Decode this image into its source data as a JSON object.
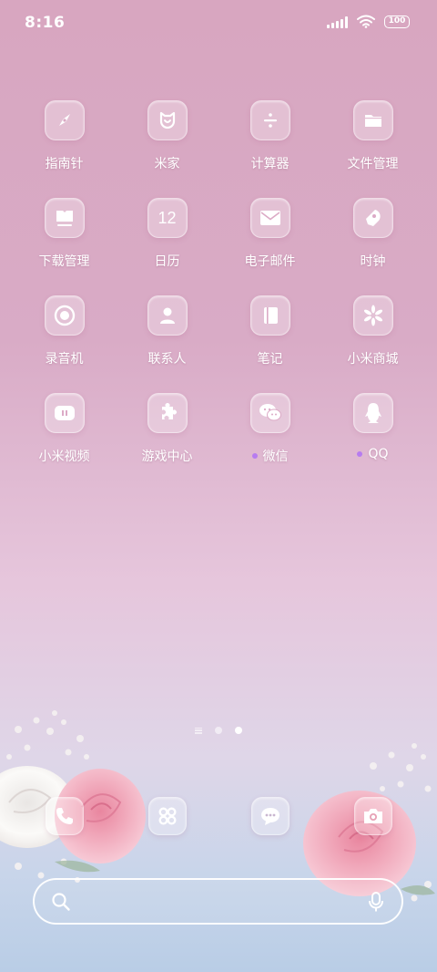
{
  "status_bar": {
    "time": "8:16",
    "battery": "100"
  },
  "apps": [
    {
      "label": "指南针",
      "icon": "compass-icon"
    },
    {
      "label": "米家",
      "icon": "mijia-icon"
    },
    {
      "label": "计算器",
      "icon": "calculator-icon"
    },
    {
      "label": "文件管理",
      "icon": "folder-icon"
    },
    {
      "label": "下载管理",
      "icon": "download-icon"
    },
    {
      "label": "日历",
      "icon": "calendar-icon",
      "badge_text": "12"
    },
    {
      "label": "电子邮件",
      "icon": "mail-icon"
    },
    {
      "label": "时钟",
      "icon": "clock-icon"
    },
    {
      "label": "录音机",
      "icon": "recorder-icon"
    },
    {
      "label": "联系人",
      "icon": "contacts-icon"
    },
    {
      "label": "笔记",
      "icon": "notes-icon"
    },
    {
      "label": "小米商城",
      "icon": "mi-store-icon"
    },
    {
      "label": "小米视频",
      "icon": "video-icon"
    },
    {
      "label": "游戏中心",
      "icon": "game-center-icon"
    },
    {
      "label": "微信",
      "icon": "wechat-icon",
      "new_dot": true
    },
    {
      "label": "QQ",
      "icon": "qq-icon",
      "new_dot": true
    }
  ],
  "dock": [
    {
      "icon": "phone-icon"
    },
    {
      "icon": "apps-launcher-icon"
    },
    {
      "icon": "messages-icon"
    },
    {
      "icon": "camera-icon"
    }
  ],
  "page_indicator": {
    "pages": 2,
    "active": 2
  },
  "colors": {
    "new_dot": "#b77cf0"
  }
}
